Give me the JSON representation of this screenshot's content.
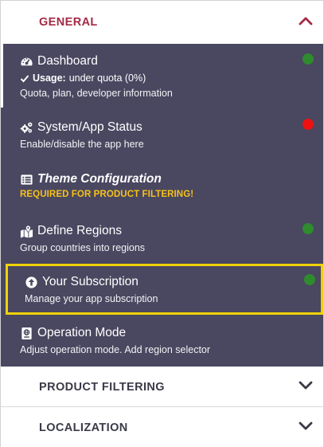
{
  "general": {
    "title": "GENERAL",
    "expanded": true,
    "icon": "chevron-up-icon"
  },
  "menu": {
    "dashboard": {
      "title": "Dashboard",
      "icon": "speedometer-icon",
      "usage_label": "Usage:",
      "usage_value": "under quota (0%)",
      "description": "Quota, plan, developer information",
      "status": "green"
    },
    "system_status": {
      "title": "System/App Status",
      "icon": "gears-icon",
      "description": "Enable/disable the app here",
      "status": "red"
    },
    "theme_configuration": {
      "title": "Theme Configuration",
      "icon": "list-alt-icon",
      "warning": "REQUIRED FOR PRODUCT FILTERING!"
    },
    "define_regions": {
      "title": "Define Regions",
      "icon": "map-marked-icon",
      "description": "Group countries into regions",
      "status": "green"
    },
    "subscription": {
      "title": "Your Subscription",
      "icon": "arrow-circle-up-icon",
      "description": "Manage your app subscription",
      "status": "green"
    },
    "operation_mode": {
      "title": "Operation Mode",
      "icon": "passport-icon",
      "description": "Adjust operation mode. Add region selector"
    }
  },
  "product_filtering": {
    "title": "PRODUCT FILTERING",
    "expanded": false,
    "icon": "chevron-down-icon"
  },
  "localization": {
    "title": "LOCALIZATION",
    "expanded": false,
    "icon": "chevron-down-icon"
  },
  "colors": {
    "menu_background": "#4a4760",
    "general_title": "#a52a45",
    "section_title": "#3a3a48",
    "status_green": "#2e8b2e",
    "status_red": "#ee1111",
    "warning_text": "#f6c21a",
    "highlight_border": "#f0d10a"
  }
}
